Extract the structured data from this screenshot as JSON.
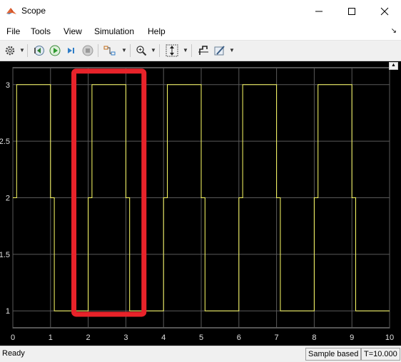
{
  "window": {
    "title": "Scope"
  },
  "menu": {
    "items": [
      "File",
      "Tools",
      "View",
      "Simulation",
      "Help"
    ]
  },
  "toolbar": {
    "icons": [
      "settings-icon",
      "step-back-icon",
      "run-icon",
      "step-forward-icon",
      "stop-icon",
      "highlight-block-icon",
      "zoom-icon",
      "scale-axes-icon",
      "cursor-measure-icon",
      "style-icon"
    ]
  },
  "chart_data": {
    "type": "line",
    "title": "",
    "xlabel": "",
    "ylabel": "",
    "xlim": [
      0,
      10
    ],
    "ylim": [
      0.85,
      3.15
    ],
    "xticks": [
      "0",
      "1",
      "2",
      "3",
      "4",
      "5",
      "6",
      "7",
      "8",
      "9",
      "10"
    ],
    "yticks": [
      "1",
      "1.5",
      "2",
      "2.5",
      "3"
    ],
    "grid": true,
    "background": "#000000",
    "series": [
      {
        "color": "#ffff66",
        "x": [
          0,
          0.1,
          0.1,
          1.0,
          1.0,
          1.1,
          1.1,
          2.0,
          2.0,
          2.1,
          2.1,
          3.0,
          3.0,
          3.1,
          3.1,
          4.0,
          4.0,
          4.1,
          4.1,
          5.0,
          5.0,
          5.1,
          5.1,
          6.0,
          6.0,
          6.1,
          6.1,
          7.0,
          7.0,
          7.1,
          7.1,
          8.0,
          8.0,
          8.1,
          8.1,
          9.0,
          9.0,
          9.1,
          9.1,
          10.0
        ],
        "y": [
          2,
          2,
          3,
          3,
          2,
          2,
          1,
          1,
          2,
          2,
          3,
          3,
          2,
          2,
          1,
          1,
          2,
          2,
          3,
          3,
          2,
          2,
          1,
          1,
          2,
          2,
          3,
          3,
          2,
          2,
          1,
          1,
          2,
          2,
          3,
          3,
          2,
          2,
          1,
          1
        ]
      }
    ],
    "annotation": {
      "type": "rectangle",
      "color": "#e8232a",
      "x": [
        1.62,
        3.48
      ],
      "y": [
        0.97,
        3.12
      ]
    }
  },
  "status": {
    "ready": "Ready",
    "mode": "Sample based",
    "time": "T=10.000"
  }
}
